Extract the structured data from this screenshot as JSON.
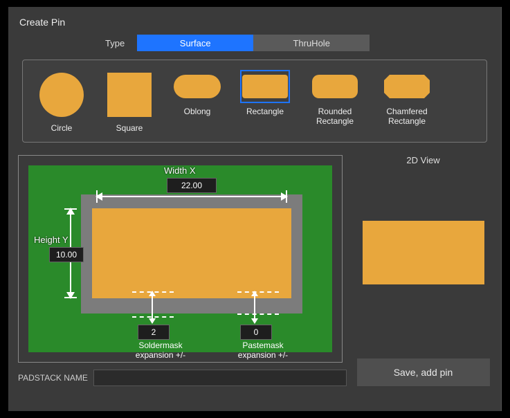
{
  "title": "Create Pin",
  "type_selector": {
    "label": "Type",
    "options": [
      "Surface",
      "ThruHole"
    ],
    "selected": 0
  },
  "shapes": [
    {
      "id": "circle",
      "label": "Circle"
    },
    {
      "id": "square",
      "label": "Square"
    },
    {
      "id": "oblong",
      "label": "Oblong"
    },
    {
      "id": "rectangle",
      "label": "Rectangle"
    },
    {
      "id": "rounded",
      "label": "Rounded Rectangle"
    },
    {
      "id": "chamfered",
      "label": "Chamfered Rectangle"
    }
  ],
  "selected_shape": "rectangle",
  "editor": {
    "width_label": "Width X",
    "width_value": "22.00",
    "height_label": "Height Y",
    "height_value": "10.00",
    "soldermask_value": "2",
    "soldermask_label": "Soldermask expansion +/-",
    "pastemask_value": "0",
    "pastemask_label": "Pastemask expansion +/-"
  },
  "padstack_name": {
    "label": "PADSTACK NAME",
    "value": ""
  },
  "preview_title": "2D View",
  "save_label": "Save, add pin"
}
